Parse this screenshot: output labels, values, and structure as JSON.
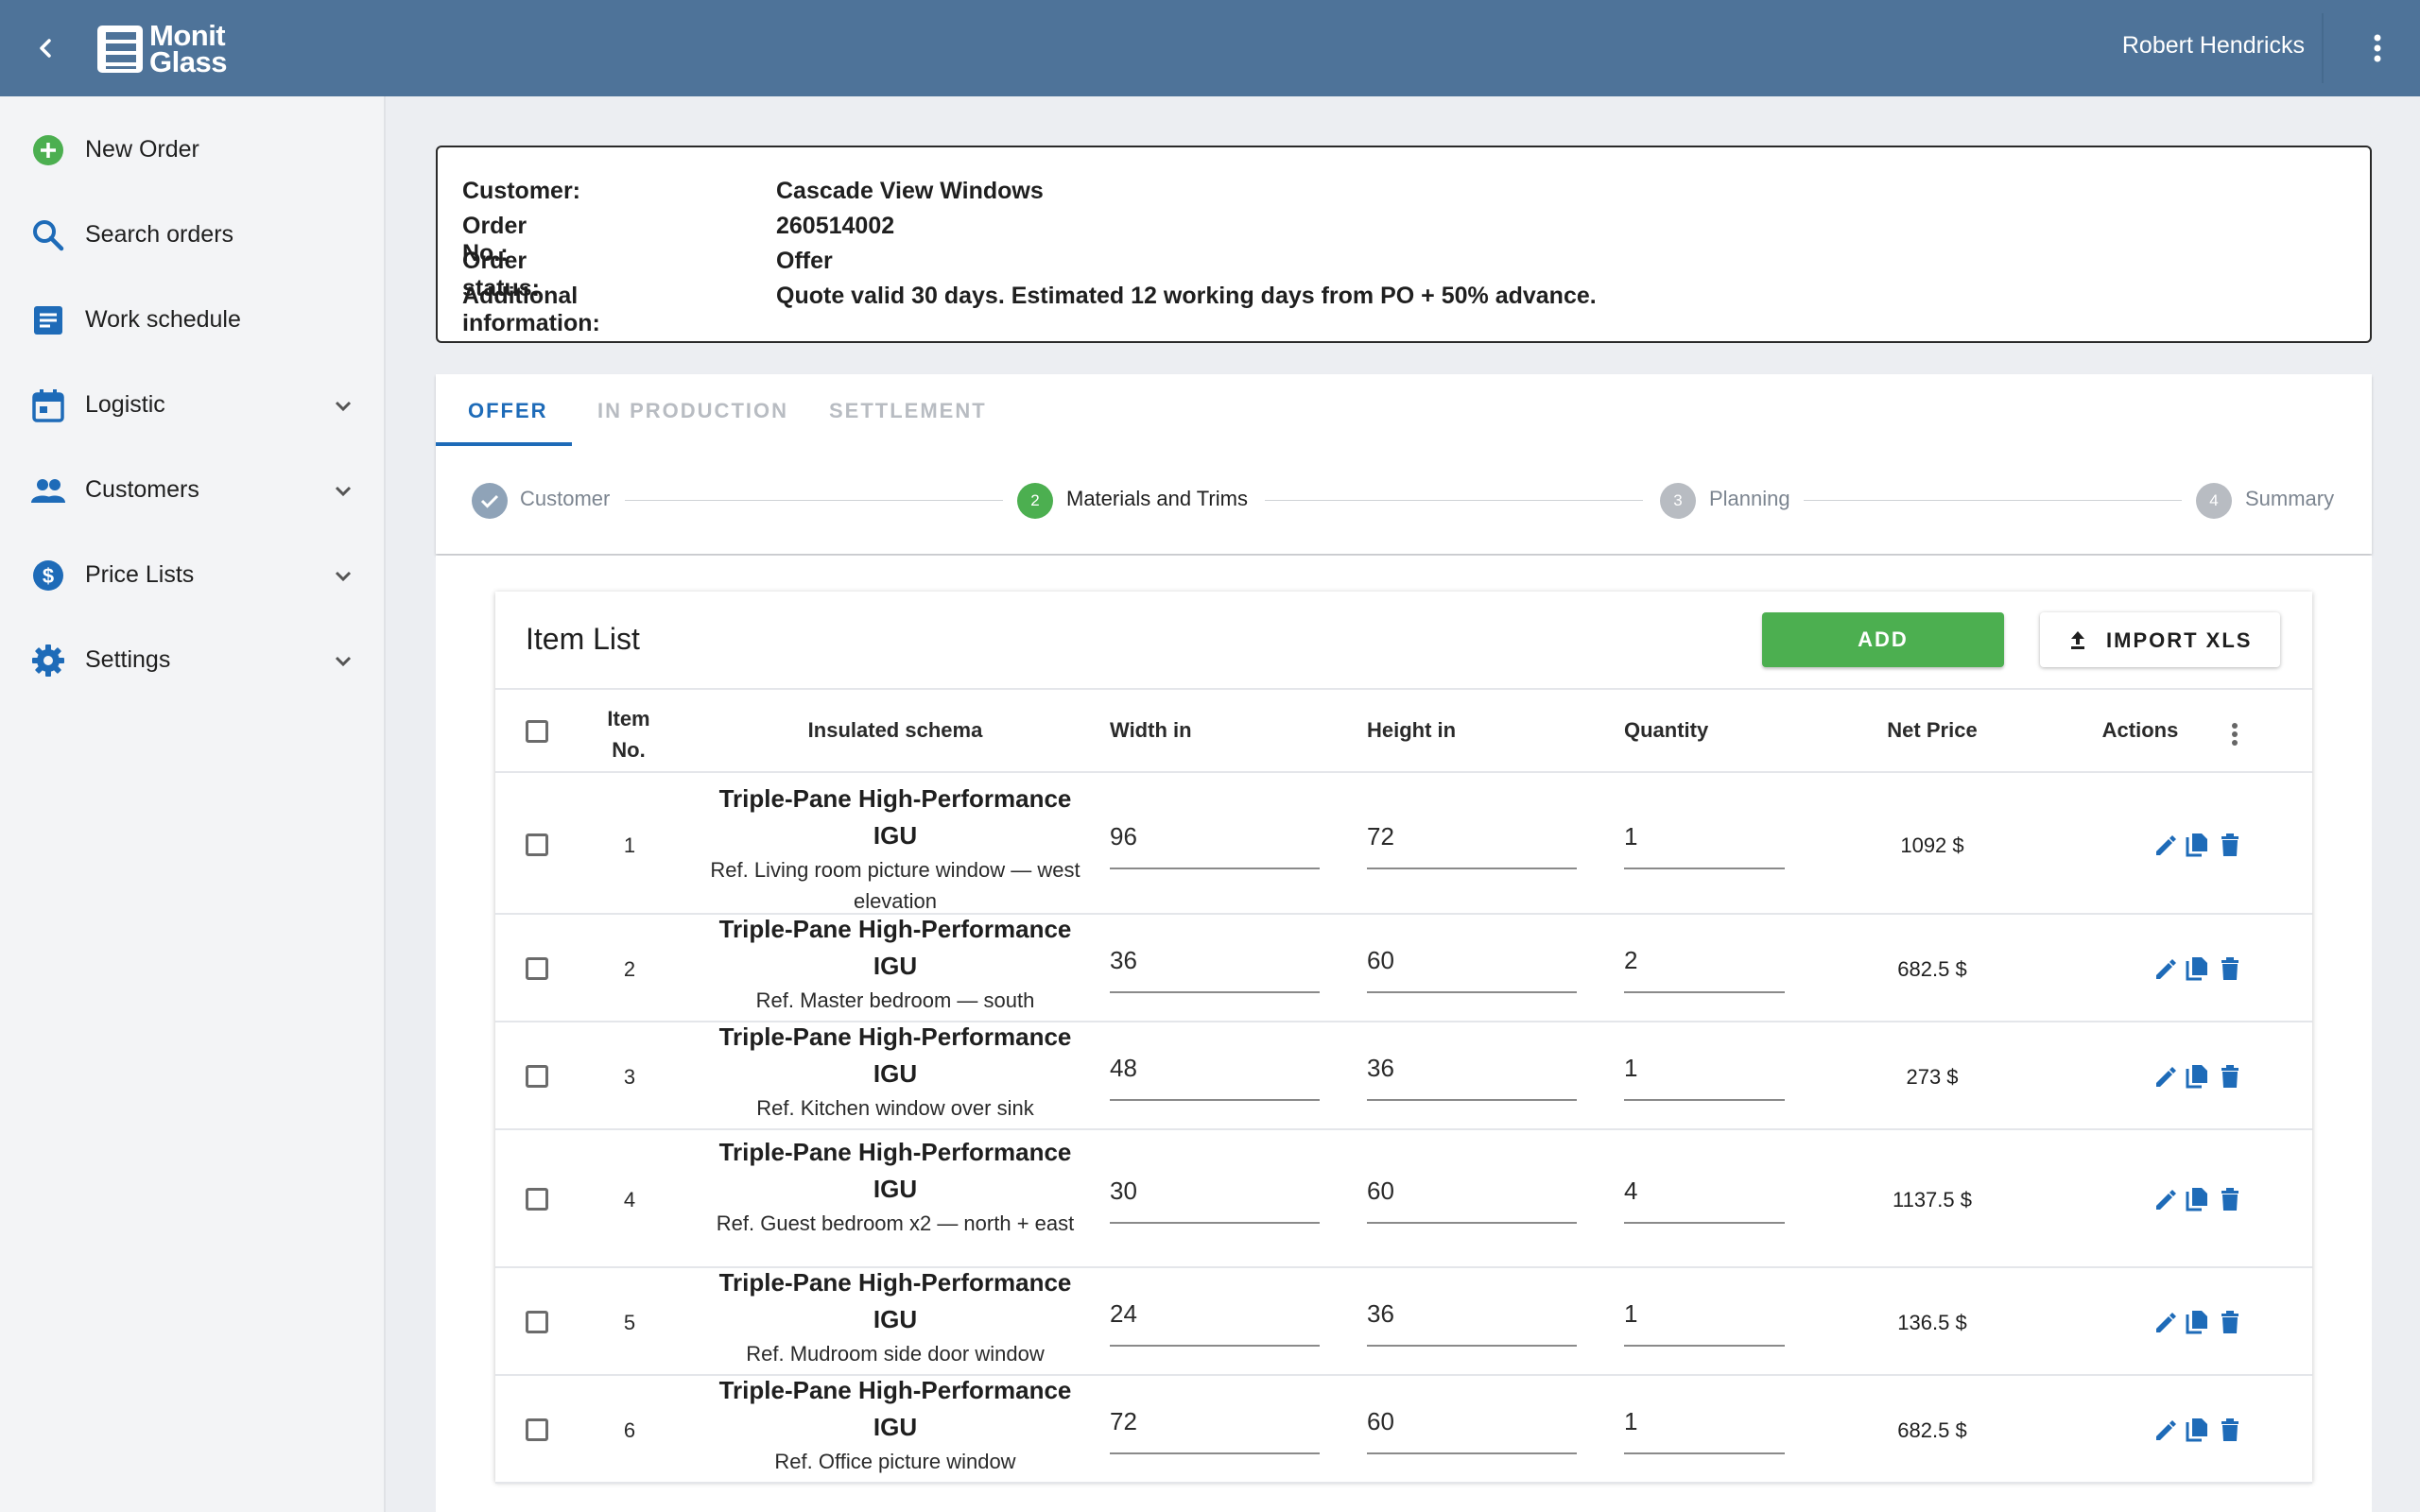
{
  "header": {
    "logo_line1": "Monit",
    "logo_line2": "Glass",
    "user_name": "Robert Hendricks"
  },
  "sidebar": {
    "items": [
      {
        "label": "New Order",
        "icon": "add-circle-icon"
      },
      {
        "label": "Search orders",
        "icon": "search-icon"
      },
      {
        "label": "Work schedule",
        "icon": "schedule-icon"
      },
      {
        "label": "Logistic",
        "icon": "calendar-icon",
        "expandable": true
      },
      {
        "label": "Customers",
        "icon": "people-icon",
        "expandable": true
      },
      {
        "label": "Price Lists",
        "icon": "dollar-icon",
        "expandable": true
      },
      {
        "label": "Settings",
        "icon": "gear-icon",
        "expandable": true
      }
    ]
  },
  "order": {
    "customer_label": "Customer:",
    "customer": "Cascade View Windows",
    "order_no_label": "Order No.:",
    "order_no": "260514002",
    "status_label": "Order status:",
    "status": "Offer",
    "info_label": "Additional information:",
    "info": "Quote valid 30 days. Estimated 12 working days from PO + 50% advance."
  },
  "tabs": [
    {
      "label": "OFFER",
      "active": true
    },
    {
      "label": "IN PRODUCTION",
      "active": false
    },
    {
      "label": "SETTLEMENT",
      "active": false
    }
  ],
  "steps": [
    {
      "number": "✓",
      "label": "Customer",
      "state": "done"
    },
    {
      "number": "2",
      "label": "Materials and Trims",
      "state": "active"
    },
    {
      "number": "3",
      "label": "Planning",
      "state": "pending"
    },
    {
      "number": "4",
      "label": "Summary",
      "state": "pending"
    }
  ],
  "item_list": {
    "title": "Item List",
    "add_label": "ADD",
    "import_label": "IMPORT XLS",
    "columns": {
      "item_no_1": "Item",
      "item_no_2": "No.",
      "schema": "Insulated schema",
      "width": "Width in",
      "height": "Height in",
      "quantity": "Quantity",
      "net_price": "Net Price",
      "actions": "Actions"
    },
    "rows": [
      {
        "no": "1",
        "name": "Triple-Pane High-Performance IGU",
        "ref": "Ref. Living room picture window — west elevation",
        "width": "96",
        "height": "72",
        "qty": "1",
        "price": "1092 $"
      },
      {
        "no": "2",
        "name": "Triple-Pane High-Performance IGU",
        "ref": "Ref. Master bedroom — south",
        "width": "36",
        "height": "60",
        "qty": "2",
        "price": "682.5 $"
      },
      {
        "no": "3",
        "name": "Triple-Pane High-Performance IGU",
        "ref": "Ref. Kitchen window over sink",
        "width": "48",
        "height": "36",
        "qty": "1",
        "price": "273 $"
      },
      {
        "no": "4",
        "name": "Triple-Pane High-Performance IGU",
        "ref": "Ref. Guest bedroom x2 — north + east",
        "width": "30",
        "height": "60",
        "qty": "4",
        "price": "1137.5 $"
      },
      {
        "no": "5",
        "name": "Triple-Pane High-Performance IGU",
        "ref": "Ref. Mudroom side door window",
        "width": "24",
        "height": "36",
        "qty": "1",
        "price": "136.5 $"
      },
      {
        "no": "6",
        "name": "Triple-Pane High-Performance IGU",
        "ref": "Ref. Office picture window",
        "width": "72",
        "height": "60",
        "qty": "1",
        "price": "682.5 $"
      }
    ]
  },
  "colors": {
    "header_bg": "#4e7399",
    "accent_blue": "#1e6bb8",
    "add_green": "#4caf50",
    "step_active": "#4caf50",
    "step_done": "#8fa3b8",
    "step_pending": "#b8bcc2"
  }
}
